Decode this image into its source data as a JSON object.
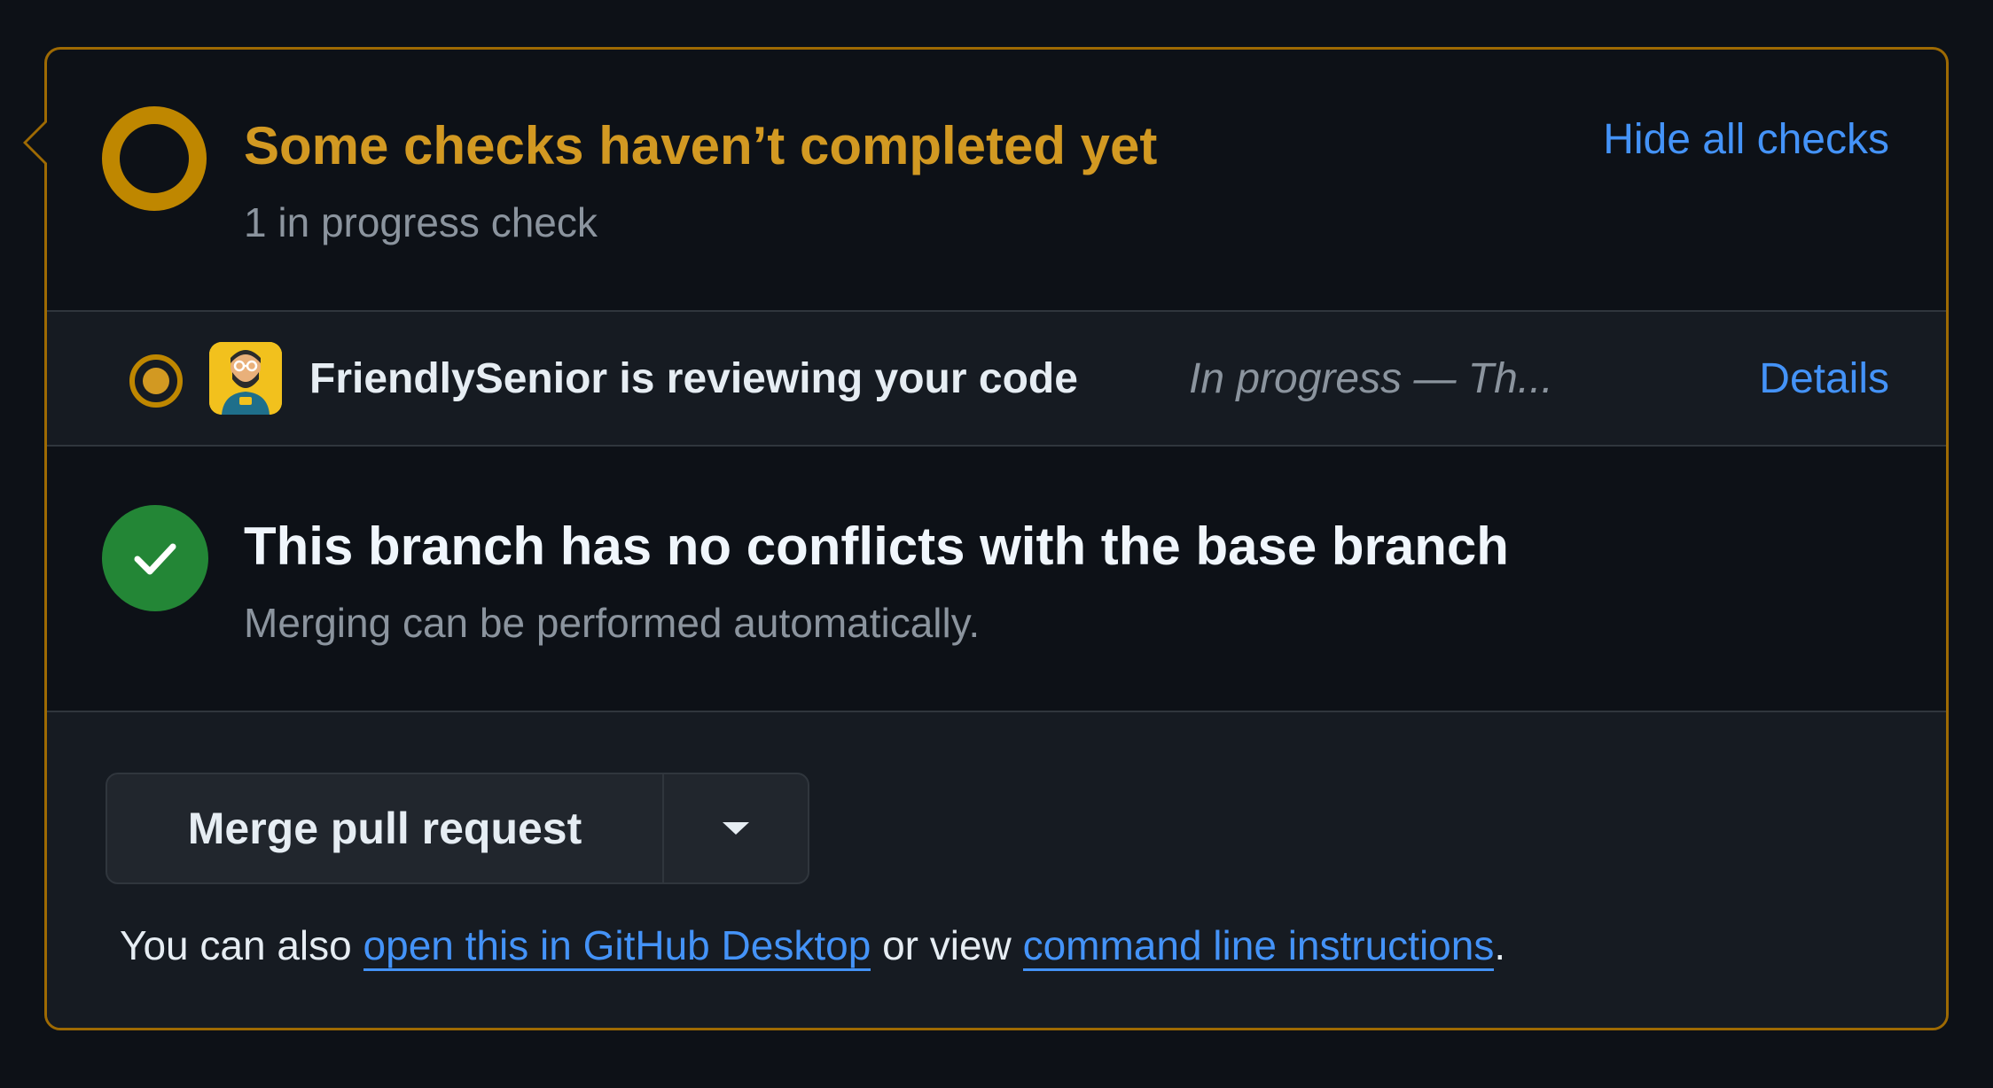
{
  "checks": {
    "title": "Some checks haven’t completed yet",
    "subtitle": "1 in progress check",
    "toggle_label": "Hide all checks",
    "status_color": "#d29922"
  },
  "check_row": {
    "status_icon": "pending-dot-icon",
    "app_icon": "friendlysenior-avatar",
    "name": "FriendlySenior is reviewing your code",
    "status": "In progress — Th...",
    "details_label": "Details"
  },
  "conflicts": {
    "icon": "check-icon",
    "title": "This branch has no conflicts with the base branch",
    "subtitle": "Merging can be performed automatically.",
    "status_color": "#238636"
  },
  "merge": {
    "button_label": "Merge pull request",
    "dropdown_icon": "triangle-down-icon",
    "note_prefix": "You can also ",
    "desktop_link": "open this in GitHub Desktop",
    "note_middle": " or view ",
    "cli_link": "command line instructions",
    "note_suffix": "."
  },
  "colors": {
    "accent_border": "#9e6a03",
    "link": "#4493f8"
  }
}
